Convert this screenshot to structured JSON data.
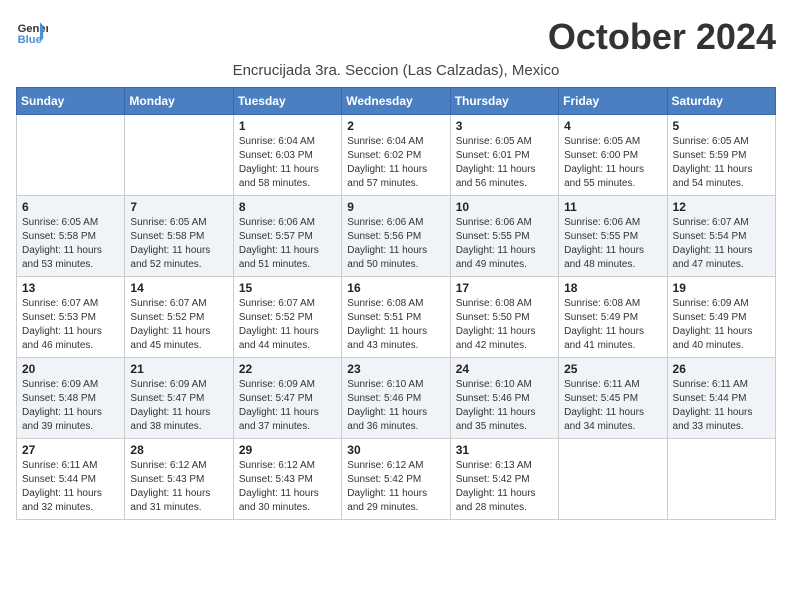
{
  "logo": {
    "general": "General",
    "blue": "Blue"
  },
  "title": "October 2024",
  "location": "Encrucijada 3ra. Seccion (Las Calzadas), Mexico",
  "weekdays": [
    "Sunday",
    "Monday",
    "Tuesday",
    "Wednesday",
    "Thursday",
    "Friday",
    "Saturday"
  ],
  "weeks": [
    [
      {
        "day": "",
        "sunrise": "",
        "sunset": "",
        "daylight": ""
      },
      {
        "day": "",
        "sunrise": "",
        "sunset": "",
        "daylight": ""
      },
      {
        "day": "1",
        "sunrise": "Sunrise: 6:04 AM",
        "sunset": "Sunset: 6:03 PM",
        "daylight": "Daylight: 11 hours and 58 minutes."
      },
      {
        "day": "2",
        "sunrise": "Sunrise: 6:04 AM",
        "sunset": "Sunset: 6:02 PM",
        "daylight": "Daylight: 11 hours and 57 minutes."
      },
      {
        "day": "3",
        "sunrise": "Sunrise: 6:05 AM",
        "sunset": "Sunset: 6:01 PM",
        "daylight": "Daylight: 11 hours and 56 minutes."
      },
      {
        "day": "4",
        "sunrise": "Sunrise: 6:05 AM",
        "sunset": "Sunset: 6:00 PM",
        "daylight": "Daylight: 11 hours and 55 minutes."
      },
      {
        "day": "5",
        "sunrise": "Sunrise: 6:05 AM",
        "sunset": "Sunset: 5:59 PM",
        "daylight": "Daylight: 11 hours and 54 minutes."
      }
    ],
    [
      {
        "day": "6",
        "sunrise": "Sunrise: 6:05 AM",
        "sunset": "Sunset: 5:58 PM",
        "daylight": "Daylight: 11 hours and 53 minutes."
      },
      {
        "day": "7",
        "sunrise": "Sunrise: 6:05 AM",
        "sunset": "Sunset: 5:58 PM",
        "daylight": "Daylight: 11 hours and 52 minutes."
      },
      {
        "day": "8",
        "sunrise": "Sunrise: 6:06 AM",
        "sunset": "Sunset: 5:57 PM",
        "daylight": "Daylight: 11 hours and 51 minutes."
      },
      {
        "day": "9",
        "sunrise": "Sunrise: 6:06 AM",
        "sunset": "Sunset: 5:56 PM",
        "daylight": "Daylight: 11 hours and 50 minutes."
      },
      {
        "day": "10",
        "sunrise": "Sunrise: 6:06 AM",
        "sunset": "Sunset: 5:55 PM",
        "daylight": "Daylight: 11 hours and 49 minutes."
      },
      {
        "day": "11",
        "sunrise": "Sunrise: 6:06 AM",
        "sunset": "Sunset: 5:55 PM",
        "daylight": "Daylight: 11 hours and 48 minutes."
      },
      {
        "day": "12",
        "sunrise": "Sunrise: 6:07 AM",
        "sunset": "Sunset: 5:54 PM",
        "daylight": "Daylight: 11 hours and 47 minutes."
      }
    ],
    [
      {
        "day": "13",
        "sunrise": "Sunrise: 6:07 AM",
        "sunset": "Sunset: 5:53 PM",
        "daylight": "Daylight: 11 hours and 46 minutes."
      },
      {
        "day": "14",
        "sunrise": "Sunrise: 6:07 AM",
        "sunset": "Sunset: 5:52 PM",
        "daylight": "Daylight: 11 hours and 45 minutes."
      },
      {
        "day": "15",
        "sunrise": "Sunrise: 6:07 AM",
        "sunset": "Sunset: 5:52 PM",
        "daylight": "Daylight: 11 hours and 44 minutes."
      },
      {
        "day": "16",
        "sunrise": "Sunrise: 6:08 AM",
        "sunset": "Sunset: 5:51 PM",
        "daylight": "Daylight: 11 hours and 43 minutes."
      },
      {
        "day": "17",
        "sunrise": "Sunrise: 6:08 AM",
        "sunset": "Sunset: 5:50 PM",
        "daylight": "Daylight: 11 hours and 42 minutes."
      },
      {
        "day": "18",
        "sunrise": "Sunrise: 6:08 AM",
        "sunset": "Sunset: 5:49 PM",
        "daylight": "Daylight: 11 hours and 41 minutes."
      },
      {
        "day": "19",
        "sunrise": "Sunrise: 6:09 AM",
        "sunset": "Sunset: 5:49 PM",
        "daylight": "Daylight: 11 hours and 40 minutes."
      }
    ],
    [
      {
        "day": "20",
        "sunrise": "Sunrise: 6:09 AM",
        "sunset": "Sunset: 5:48 PM",
        "daylight": "Daylight: 11 hours and 39 minutes."
      },
      {
        "day": "21",
        "sunrise": "Sunrise: 6:09 AM",
        "sunset": "Sunset: 5:47 PM",
        "daylight": "Daylight: 11 hours and 38 minutes."
      },
      {
        "day": "22",
        "sunrise": "Sunrise: 6:09 AM",
        "sunset": "Sunset: 5:47 PM",
        "daylight": "Daylight: 11 hours and 37 minutes."
      },
      {
        "day": "23",
        "sunrise": "Sunrise: 6:10 AM",
        "sunset": "Sunset: 5:46 PM",
        "daylight": "Daylight: 11 hours and 36 minutes."
      },
      {
        "day": "24",
        "sunrise": "Sunrise: 6:10 AM",
        "sunset": "Sunset: 5:46 PM",
        "daylight": "Daylight: 11 hours and 35 minutes."
      },
      {
        "day": "25",
        "sunrise": "Sunrise: 6:11 AM",
        "sunset": "Sunset: 5:45 PM",
        "daylight": "Daylight: 11 hours and 34 minutes."
      },
      {
        "day": "26",
        "sunrise": "Sunrise: 6:11 AM",
        "sunset": "Sunset: 5:44 PM",
        "daylight": "Daylight: 11 hours and 33 minutes."
      }
    ],
    [
      {
        "day": "27",
        "sunrise": "Sunrise: 6:11 AM",
        "sunset": "Sunset: 5:44 PM",
        "daylight": "Daylight: 11 hours and 32 minutes."
      },
      {
        "day": "28",
        "sunrise": "Sunrise: 6:12 AM",
        "sunset": "Sunset: 5:43 PM",
        "daylight": "Daylight: 11 hours and 31 minutes."
      },
      {
        "day": "29",
        "sunrise": "Sunrise: 6:12 AM",
        "sunset": "Sunset: 5:43 PM",
        "daylight": "Daylight: 11 hours and 30 minutes."
      },
      {
        "day": "30",
        "sunrise": "Sunrise: 6:12 AM",
        "sunset": "Sunset: 5:42 PM",
        "daylight": "Daylight: 11 hours and 29 minutes."
      },
      {
        "day": "31",
        "sunrise": "Sunrise: 6:13 AM",
        "sunset": "Sunset: 5:42 PM",
        "daylight": "Daylight: 11 hours and 28 minutes."
      },
      {
        "day": "",
        "sunrise": "",
        "sunset": "",
        "daylight": ""
      },
      {
        "day": "",
        "sunrise": "",
        "sunset": "",
        "daylight": ""
      }
    ]
  ]
}
